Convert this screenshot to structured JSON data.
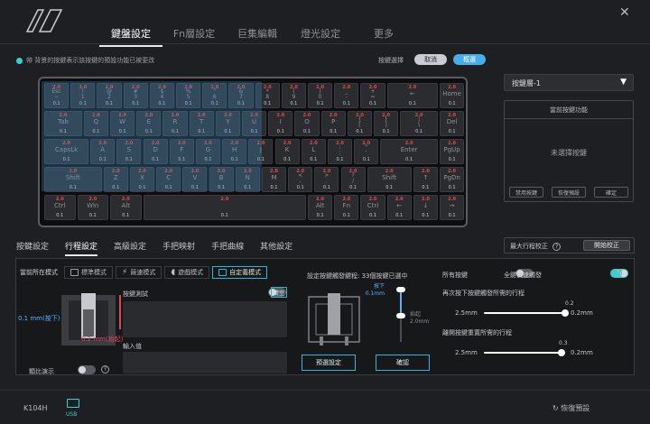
{
  "window": {
    "close_icon": "close-icon",
    "logo": "brand-logo"
  },
  "nav": {
    "tabs": [
      "鍵盤設定",
      "Fn層設定",
      "巨集編輯",
      "燈光設定",
      "更多"
    ],
    "active": 0
  },
  "hint": "帶 背景的按鍵表示該按鍵的預設功能已被更改",
  "select_label": "按鍵選擇",
  "select_btns": [
    "取消",
    "框選"
  ],
  "keyboard": {
    "rows": [
      [
        [
          "2.0",
          "Esc\n~",
          "0.1"
        ],
        [
          "2.0",
          "!\n1",
          "0.1"
        ],
        [
          "2.0",
          "@\n2",
          "0.1"
        ],
        [
          "2.0",
          "#\n3",
          "0.1"
        ],
        [
          "2.0",
          "$\n4",
          "0.1"
        ],
        [
          "2.0",
          "%\n5",
          "0.1"
        ],
        [
          "2.0",
          "^\n6",
          "0.1"
        ],
        [
          "2.0",
          "&\n7",
          "0.1"
        ],
        [
          "2.0",
          "*\n8",
          "0.1"
        ],
        [
          "2.0",
          "(\n9",
          "0.1"
        ],
        [
          "2.0",
          ")\n0",
          "0.1"
        ],
        [
          "2.0",
          "_\n-",
          "0.1"
        ],
        [
          "2.0",
          "+\n=",
          "0.1"
        ],
        [
          "2.0",
          "←",
          "0.1"
        ],
        [
          "2.0",
          "Home",
          "0.1"
        ]
      ],
      [
        [
          "2.0",
          "Tab",
          "0.1"
        ],
        [
          "2.0",
          "Q",
          "0.1"
        ],
        [
          "2.0",
          "W",
          "0.1"
        ],
        [
          "2.0",
          "E",
          "0.1"
        ],
        [
          "2.0",
          "R",
          "0.1"
        ],
        [
          "2.0",
          "T",
          "0.1"
        ],
        [
          "2.0",
          "Y",
          "0.1"
        ],
        [
          "2.0",
          "U",
          "0.1"
        ],
        [
          "2.0",
          "I",
          "0.1"
        ],
        [
          "2.0",
          "O",
          "0.1"
        ],
        [
          "2.0",
          "P",
          "0.1"
        ],
        [
          "2.0",
          "{\n[",
          "0.1"
        ],
        [
          "2.0",
          "}\n]",
          "0.1"
        ],
        [
          "2.0",
          "|\n\\",
          "0.1"
        ],
        [
          "2.0",
          "Del",
          "0.1"
        ]
      ],
      [
        [
          "2.0",
          "CapsLk",
          "0.1"
        ],
        [
          "2.0",
          "A",
          "0.1"
        ],
        [
          "2.0",
          "S",
          "0.1"
        ],
        [
          "2.0",
          "D",
          "0.1"
        ],
        [
          "2.0",
          "F",
          "0.1"
        ],
        [
          "2.0",
          "G",
          "0.1"
        ],
        [
          "2.0",
          "H",
          "0.1"
        ],
        [
          "2.0",
          "J",
          "0.1"
        ],
        [
          "2.0",
          "K",
          "0.1"
        ],
        [
          "2.0",
          "L",
          "0.1"
        ],
        [
          "2.0",
          ":\n;",
          "0.1"
        ],
        [
          "2.0",
          "\"\n'",
          "0.1"
        ],
        [
          "2.0",
          "Enter",
          "0.1"
        ],
        [
          "2.0",
          "PgUp",
          "0.1"
        ]
      ],
      [
        [
          "2.0",
          "Shift",
          "0.1"
        ],
        [
          "2.0",
          "Z",
          "0.1"
        ],
        [
          "2.0",
          "X",
          "0.1"
        ],
        [
          "2.0",
          "C",
          "0.1"
        ],
        [
          "2.0",
          "V",
          "0.1"
        ],
        [
          "2.0",
          "B",
          "0.1"
        ],
        [
          "2.0",
          "N",
          "0.1"
        ],
        [
          "2.0",
          "M",
          "0.1"
        ],
        [
          "2.0",
          "<\n,",
          "0.1"
        ],
        [
          "2.0",
          ">\n.",
          "0.1"
        ],
        [
          "2.0",
          "?\n/",
          "0.1"
        ],
        [
          "2.0",
          "Shift",
          "0.1"
        ],
        [
          "2.0",
          "↑",
          "0.1"
        ],
        [
          "2.0",
          "PgDn",
          "0.1"
        ]
      ],
      [
        [
          "2.0",
          "Ctrl",
          "0.1"
        ],
        [
          "2.0",
          "Win",
          "0.1"
        ],
        [
          "2.0",
          "Alt",
          "0.1"
        ],
        [
          "2.0",
          "",
          "0.1"
        ],
        [
          "2.0",
          "Alt",
          "0.1"
        ],
        [
          "2.0",
          "Fn",
          "0.1"
        ],
        [
          "2.0",
          "Ctrl",
          "0.1"
        ],
        [
          "2.0",
          "←",
          "0.1"
        ],
        [
          "2.0",
          "↓",
          "0.1"
        ],
        [
          "2.0",
          "→",
          "0.1"
        ]
      ]
    ]
  },
  "layer": {
    "value": "按鍵層-1"
  },
  "keypanel": {
    "title": "當前按鍵功能",
    "empty": "未選擇按鍵",
    "btns": [
      "禁用按鍵",
      "恢復預設",
      "確定"
    ]
  },
  "subtabs": {
    "items": [
      "按鍵設定",
      "行程設定",
      "高級設定",
      "手把映射",
      "手把曲線",
      "其他設定"
    ],
    "active": 1
  },
  "maxtrip": {
    "label": "最大行程校正",
    "btn": "開始校正"
  },
  "mode": {
    "label": "當前所在模式",
    "items": [
      "標準模式",
      "競速模式",
      "遊戲模式",
      "自定義模式"
    ],
    "active": 3
  },
  "left": {
    "test_label": "按鍵測試",
    "clear": "清空",
    "press_label": "0.1 mm(按下)",
    "release_label": "0.2 mm(抬起)",
    "input_label": "輸入值",
    "compare_label": "類比演示"
  },
  "mid": {
    "title": "設定按鍵觸發鍵程: 33個按鍵已選中",
    "press_tag": "按下",
    "press_val": "0.1mm",
    "release_tag": "抬起",
    "release_val": "2.0mm",
    "btn_preset": "預選設定",
    "btn_ok": "確認"
  },
  "right": {
    "all_keys": "所有按鍵",
    "quick_label": "全鍵快速觸發",
    "press_title": "再次按下按鍵觸發所需的行程",
    "press_min": "2.5mm",
    "press_max": "0.2mm",
    "press_val": "0.2",
    "release_title": "離開按鍵重置所需的行程",
    "release_min": "2.5mm",
    "release_max": "0.2mm",
    "release_val": "0.3"
  },
  "footer": {
    "device": "K104H",
    "usb": "USB",
    "reset": "恢復預設"
  }
}
